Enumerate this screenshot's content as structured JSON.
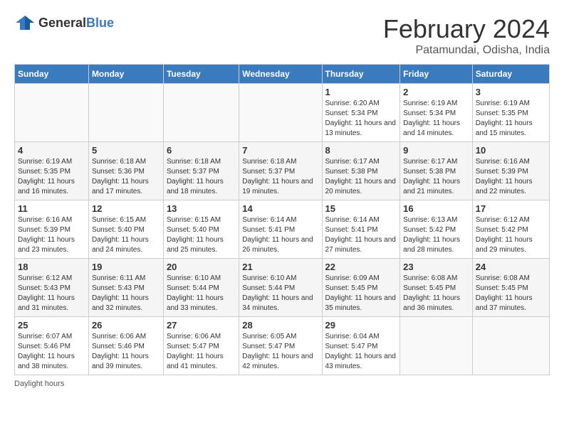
{
  "header": {
    "logo_general": "General",
    "logo_blue": "Blue",
    "month_title": "February 2024",
    "location": "Patamundai, Odisha, India"
  },
  "days_of_week": [
    "Sunday",
    "Monday",
    "Tuesday",
    "Wednesday",
    "Thursday",
    "Friday",
    "Saturday"
  ],
  "weeks": [
    [
      {
        "day": "",
        "info": ""
      },
      {
        "day": "",
        "info": ""
      },
      {
        "day": "",
        "info": ""
      },
      {
        "day": "",
        "info": ""
      },
      {
        "day": "1",
        "info": "Sunrise: 6:20 AM\nSunset: 5:34 PM\nDaylight: 11 hours and 13 minutes."
      },
      {
        "day": "2",
        "info": "Sunrise: 6:19 AM\nSunset: 5:34 PM\nDaylight: 11 hours and 14 minutes."
      },
      {
        "day": "3",
        "info": "Sunrise: 6:19 AM\nSunset: 5:35 PM\nDaylight: 11 hours and 15 minutes."
      }
    ],
    [
      {
        "day": "4",
        "info": "Sunrise: 6:19 AM\nSunset: 5:35 PM\nDaylight: 11 hours and 16 minutes."
      },
      {
        "day": "5",
        "info": "Sunrise: 6:18 AM\nSunset: 5:36 PM\nDaylight: 11 hours and 17 minutes."
      },
      {
        "day": "6",
        "info": "Sunrise: 6:18 AM\nSunset: 5:37 PM\nDaylight: 11 hours and 18 minutes."
      },
      {
        "day": "7",
        "info": "Sunrise: 6:18 AM\nSunset: 5:37 PM\nDaylight: 11 hours and 19 minutes."
      },
      {
        "day": "8",
        "info": "Sunrise: 6:17 AM\nSunset: 5:38 PM\nDaylight: 11 hours and 20 minutes."
      },
      {
        "day": "9",
        "info": "Sunrise: 6:17 AM\nSunset: 5:38 PM\nDaylight: 11 hours and 21 minutes."
      },
      {
        "day": "10",
        "info": "Sunrise: 6:16 AM\nSunset: 5:39 PM\nDaylight: 11 hours and 22 minutes."
      }
    ],
    [
      {
        "day": "11",
        "info": "Sunrise: 6:16 AM\nSunset: 5:39 PM\nDaylight: 11 hours and 23 minutes."
      },
      {
        "day": "12",
        "info": "Sunrise: 6:15 AM\nSunset: 5:40 PM\nDaylight: 11 hours and 24 minutes."
      },
      {
        "day": "13",
        "info": "Sunrise: 6:15 AM\nSunset: 5:40 PM\nDaylight: 11 hours and 25 minutes."
      },
      {
        "day": "14",
        "info": "Sunrise: 6:14 AM\nSunset: 5:41 PM\nDaylight: 11 hours and 26 minutes."
      },
      {
        "day": "15",
        "info": "Sunrise: 6:14 AM\nSunset: 5:41 PM\nDaylight: 11 hours and 27 minutes."
      },
      {
        "day": "16",
        "info": "Sunrise: 6:13 AM\nSunset: 5:42 PM\nDaylight: 11 hours and 28 minutes."
      },
      {
        "day": "17",
        "info": "Sunrise: 6:12 AM\nSunset: 5:42 PM\nDaylight: 11 hours and 29 minutes."
      }
    ],
    [
      {
        "day": "18",
        "info": "Sunrise: 6:12 AM\nSunset: 5:43 PM\nDaylight: 11 hours and 31 minutes."
      },
      {
        "day": "19",
        "info": "Sunrise: 6:11 AM\nSunset: 5:43 PM\nDaylight: 11 hours and 32 minutes."
      },
      {
        "day": "20",
        "info": "Sunrise: 6:10 AM\nSunset: 5:44 PM\nDaylight: 11 hours and 33 minutes."
      },
      {
        "day": "21",
        "info": "Sunrise: 6:10 AM\nSunset: 5:44 PM\nDaylight: 11 hours and 34 minutes."
      },
      {
        "day": "22",
        "info": "Sunrise: 6:09 AM\nSunset: 5:45 PM\nDaylight: 11 hours and 35 minutes."
      },
      {
        "day": "23",
        "info": "Sunrise: 6:08 AM\nSunset: 5:45 PM\nDaylight: 11 hours and 36 minutes."
      },
      {
        "day": "24",
        "info": "Sunrise: 6:08 AM\nSunset: 5:45 PM\nDaylight: 11 hours and 37 minutes."
      }
    ],
    [
      {
        "day": "25",
        "info": "Sunrise: 6:07 AM\nSunset: 5:46 PM\nDaylight: 11 hours and 38 minutes."
      },
      {
        "day": "26",
        "info": "Sunrise: 6:06 AM\nSunset: 5:46 PM\nDaylight: 11 hours and 39 minutes."
      },
      {
        "day": "27",
        "info": "Sunrise: 6:06 AM\nSunset: 5:47 PM\nDaylight: 11 hours and 41 minutes."
      },
      {
        "day": "28",
        "info": "Sunrise: 6:05 AM\nSunset: 5:47 PM\nDaylight: 11 hours and 42 minutes."
      },
      {
        "day": "29",
        "info": "Sunrise: 6:04 AM\nSunset: 5:47 PM\nDaylight: 11 hours and 43 minutes."
      },
      {
        "day": "",
        "info": ""
      },
      {
        "day": "",
        "info": ""
      }
    ]
  ],
  "footer": {
    "note": "Daylight hours"
  }
}
